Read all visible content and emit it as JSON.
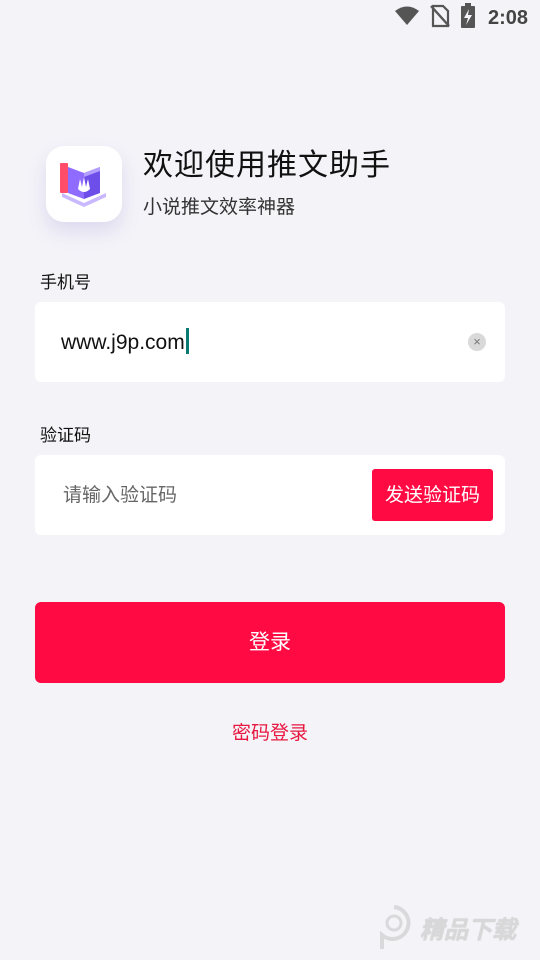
{
  "status_bar": {
    "time": "2:08",
    "icons": [
      "wifi-icon",
      "no-sim-icon",
      "battery-charging-icon"
    ]
  },
  "header": {
    "title": "欢迎使用推文助手",
    "subtitle": "小说推文效率神器"
  },
  "phone": {
    "label": "手机号",
    "value": "www.j9p.com"
  },
  "code": {
    "label": "验证码",
    "placeholder": "请输入验证码",
    "send_button": "发送验证码"
  },
  "login_button": "登录",
  "password_login_link": "密码登录",
  "watermark": {
    "text": "精品下载"
  },
  "colors": {
    "accent": "#ff0a42",
    "link": "#e8173f",
    "background": "#f4f3f8"
  }
}
